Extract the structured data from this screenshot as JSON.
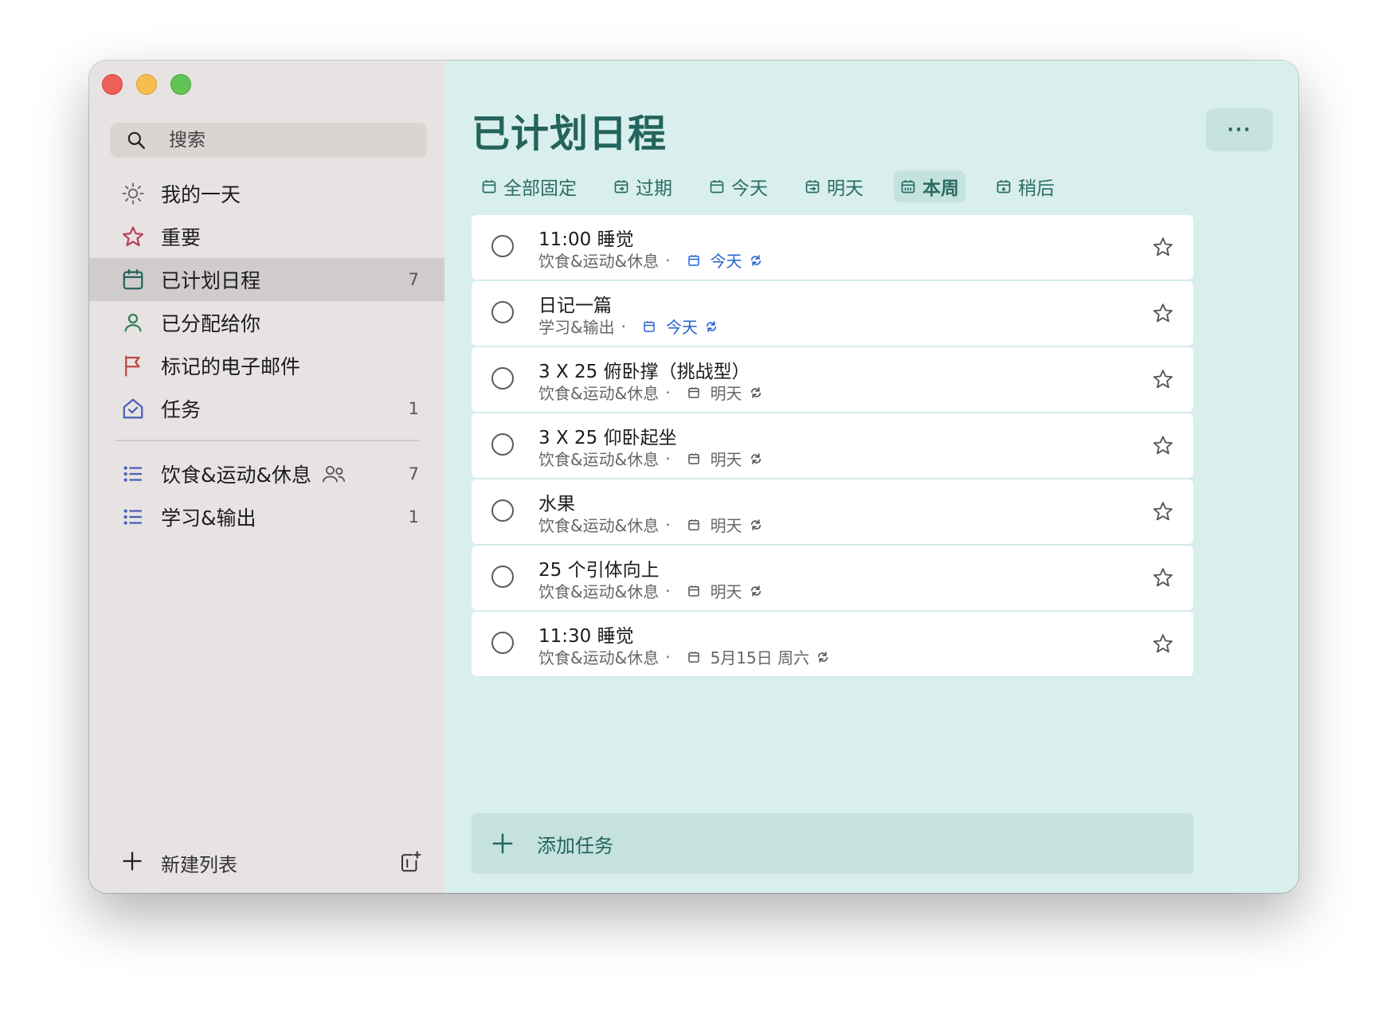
{
  "window": {
    "controls": [
      "close",
      "minimize",
      "zoom"
    ]
  },
  "sidebar": {
    "search": {
      "placeholder": "搜索",
      "icon": "search-icon"
    },
    "items": [
      {
        "label": "我的一天",
        "icon": "sun-icon",
        "count": "",
        "color": "#6b6b6b"
      },
      {
        "label": "重要",
        "icon": "star-icon",
        "count": "",
        "color": "#b8405e"
      },
      {
        "label": "已计划日程",
        "icon": "calendar-icon",
        "count": "7",
        "color": "#23645c",
        "active": true
      },
      {
        "label": "已分配给你",
        "icon": "person-icon",
        "count": "",
        "color": "#2f7d56"
      },
      {
        "label": "标记的电子邮件",
        "icon": "flag-icon",
        "count": "",
        "color": "#c0463d"
      },
      {
        "label": "任务",
        "icon": "home-icon",
        "count": "1",
        "color": "#4a5fb8"
      }
    ],
    "lists": [
      {
        "label": "饮食&运动&休息",
        "icon": "list-icon",
        "count": "7",
        "shared": true
      },
      {
        "label": "学习&输出",
        "icon": "list-icon",
        "count": "1",
        "shared": false
      }
    ],
    "new_list_label": "新建列表"
  },
  "main": {
    "title": "已计划日程",
    "more_label": "···",
    "filters": [
      {
        "label": "全部固定",
        "icon": "calendar-icon"
      },
      {
        "label": "过期",
        "icon": "calendar-overdue-icon"
      },
      {
        "label": "今天",
        "icon": "calendar-icon"
      },
      {
        "label": "明天",
        "icon": "calendar-arrow-icon"
      },
      {
        "label": "本周",
        "icon": "calendar-week-icon",
        "active": true
      },
      {
        "label": "稍后",
        "icon": "calendar-down-icon"
      }
    ],
    "tasks": [
      {
        "title": "11:00 睡觉",
        "list": "饮食&运动&休息",
        "dot": "·",
        "due": "今天",
        "due_today": true
      },
      {
        "title": "日记一篇",
        "list": "学习&输出",
        "dot": "·",
        "due": "今天",
        "due_today": true
      },
      {
        "title": "3 X 25 俯卧撑（挑战型）",
        "list": "饮食&运动&休息",
        "dot": "·",
        "due": "明天",
        "due_today": false
      },
      {
        "title": "3 X 25 仰卧起坐",
        "list": "饮食&运动&休息",
        "dot": "·",
        "due": "明天",
        "due_today": false
      },
      {
        "title": "水果",
        "list": "饮食&运动&休息",
        "dot": "·",
        "due": "明天",
        "due_today": false
      },
      {
        "title": "25 个引体向上",
        "list": "饮食&运动&休息",
        "dot": "·",
        "due": "明天",
        "due_today": false
      },
      {
        "title": "11:30 睡觉",
        "list": "饮食&运动&休息",
        "dot": "·",
        "due": "5月15日 周六",
        "due_today": false
      }
    ],
    "add_task_label": "添加任务"
  },
  "colors": {
    "accent": "#23645c",
    "today_blue": "#2563d0",
    "main_bg": "#d9efed",
    "sidebar_bg": "#e7e3e2"
  }
}
